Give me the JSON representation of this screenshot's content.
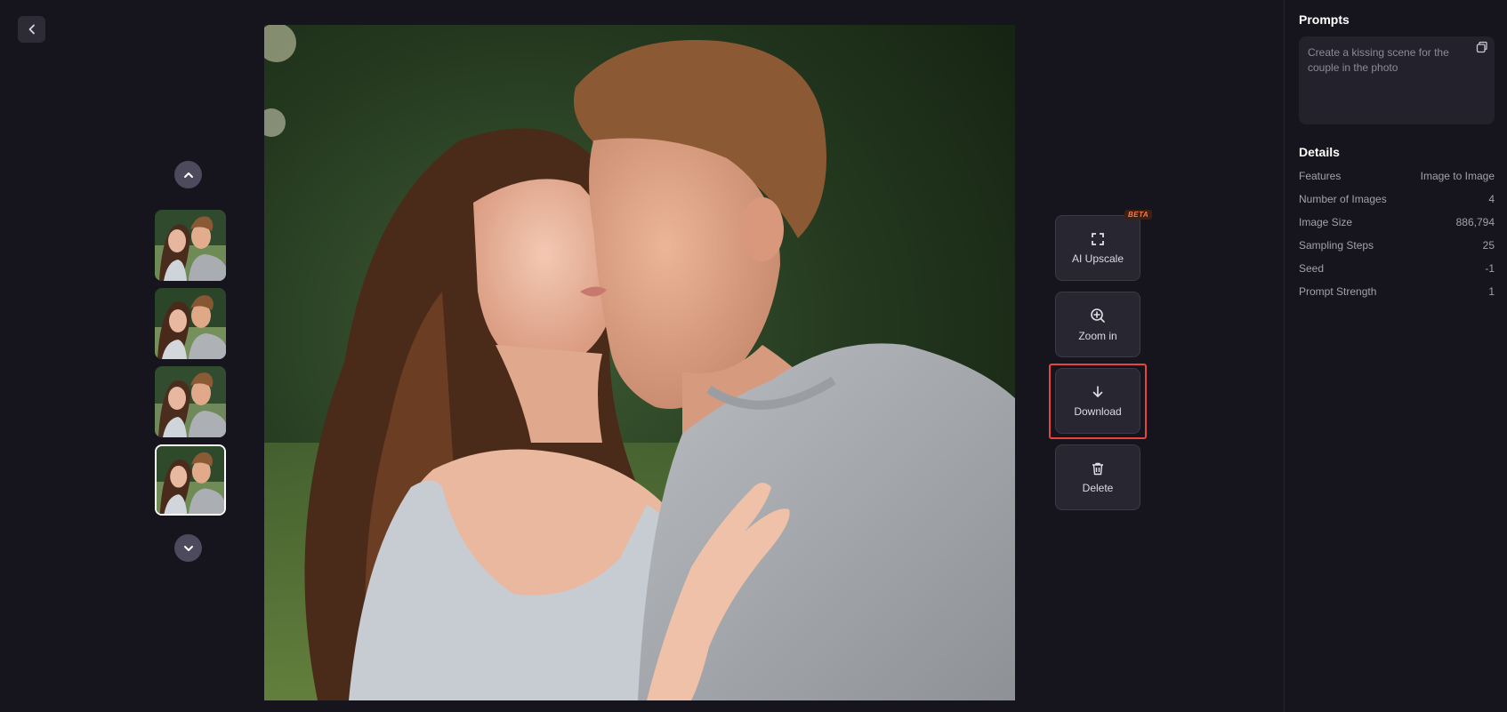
{
  "left": {
    "back_icon": "chevron-left-icon",
    "thumbnails_up_icon": "chevron-up-icon",
    "thumbnails_down_icon": "chevron-down-icon",
    "thumbnail_count": 4,
    "selected_thumbnail": 4
  },
  "actions": {
    "upscale": {
      "label": "AI Upscale",
      "badge": "BETA",
      "icon": "expand-icon"
    },
    "zoom": {
      "label": "Zoom in",
      "icon": "zoom-in-icon"
    },
    "download": {
      "label": "Download",
      "icon": "download-icon"
    },
    "delete": {
      "label": "Delete",
      "icon": "trash-icon"
    }
  },
  "panel": {
    "prompts_title": "Prompts",
    "prompt_text": "Create a kissing scene for the couple in the photo",
    "details_title": "Details",
    "details": [
      {
        "label": "Features",
        "value": "Image to Image"
      },
      {
        "label": "Number of Images",
        "value": "4"
      },
      {
        "label": "Image Size",
        "value": "886,794"
      },
      {
        "label": "Sampling Steps",
        "value": "25"
      },
      {
        "label": "Seed",
        "value": "-1"
      },
      {
        "label": "Prompt Strength",
        "value": "1"
      }
    ]
  },
  "colors": {
    "background": "#16141d",
    "button_bg": "#272631",
    "highlight": "#e8453c",
    "beta": "#ff7a45"
  }
}
